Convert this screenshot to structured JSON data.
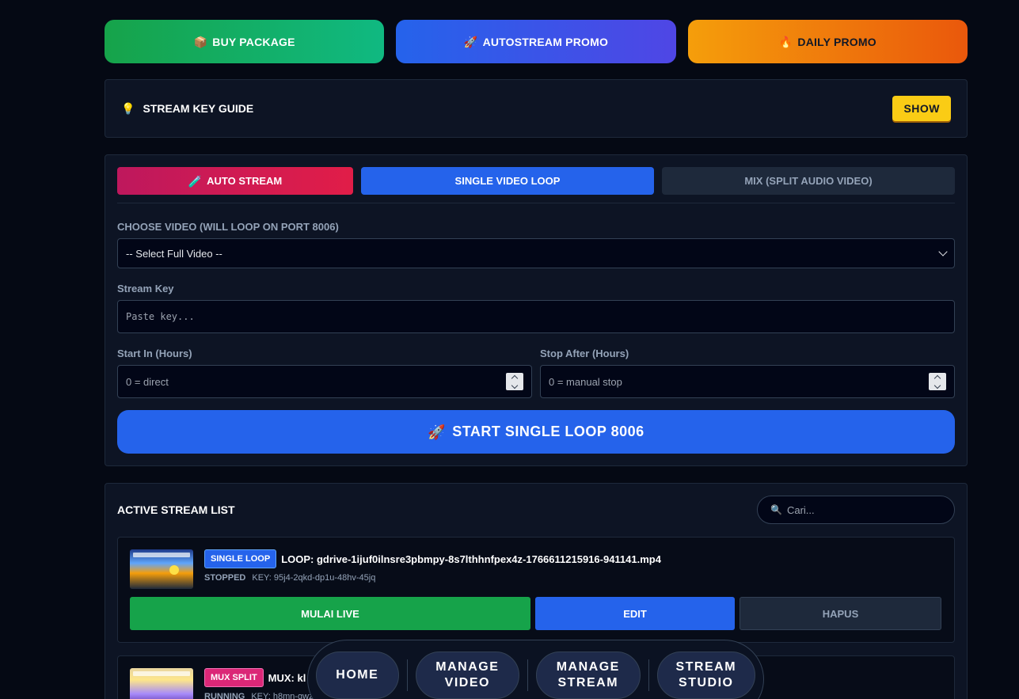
{
  "promo": {
    "buy": {
      "icon": "package-icon",
      "emoji": "📦",
      "label": "BUY PACKAGE"
    },
    "autostream": {
      "icon": "rocket-icon",
      "emoji": "🚀",
      "label": "AUTOSTREAM PROMO"
    },
    "daily": {
      "icon": "fire-icon",
      "emoji": "🔥",
      "label": "DAILY PROMO"
    }
  },
  "guide": {
    "icon": "lightbulb-icon",
    "emoji": "💡",
    "title": "STREAM KEY GUIDE",
    "show_label": "SHOW"
  },
  "modes": {
    "auto": {
      "emoji": "🧪",
      "label": "AUTO STREAM"
    },
    "single": {
      "label": "SINGLE VIDEO LOOP"
    },
    "mix": {
      "label": "MIX (SPLIT AUDIO VIDEO)"
    }
  },
  "form": {
    "video_label": "CHOOSE VIDEO (WILL LOOP ON PORT 8006)",
    "video_selected": "-- Select Full Video --",
    "key_label": "Stream Key",
    "key_placeholder": "Paste key...",
    "start_label": "Start In (Hours)",
    "start_placeholder": "0 = direct",
    "stop_label": "Stop After (Hours)",
    "stop_placeholder": "0 = manual stop",
    "submit_emoji": "🚀",
    "submit_label": "START SINGLE LOOP 8006"
  },
  "list": {
    "title": "ACTIVE STREAM LIST",
    "search_emoji": "🔍",
    "search_placeholder": "Cari...",
    "items": [
      {
        "badge": "SINGLE LOOP",
        "name": "LOOP: gdrive-1ijuf0ilnsre3pbmpy-8s7lthhnfpex4z-1766611215916-941141.mp4",
        "status": "STOPPED",
        "key": "KEY: 95j4-2qkd-dp1u-48hv-45jq",
        "live_label": "MULAI LIVE",
        "edit_label": "EDIT",
        "delete_label": "HAPUS"
      },
      {
        "badge": "MUX SPLIT",
        "name": "MUX: kl",
        "status": "RUNNING",
        "key": "KEY: h8mn-gwz"
      }
    ]
  },
  "nav": {
    "home": "HOME",
    "manage_video": "MANAGE\nVIDEO",
    "manage_stream": "MANAGE\nSTREAM",
    "stream_studio": "STREAM\nSTUDIO"
  }
}
